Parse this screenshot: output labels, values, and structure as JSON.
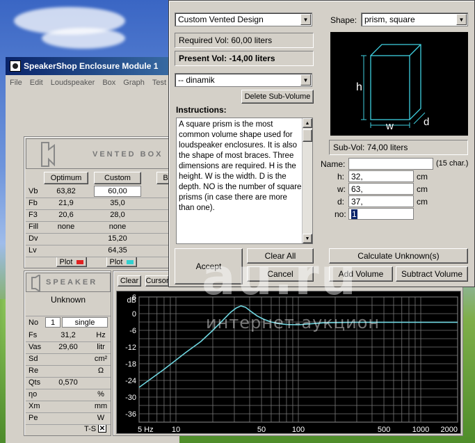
{
  "main_window": {
    "title": "SpeakerShop Enclosure Module 1",
    "menu": [
      "File",
      "Edit",
      "Loudspeaker",
      "Box",
      "Graph",
      "Test"
    ]
  },
  "vented_box": {
    "header": "VENTED BOX",
    "col_optimum": "Optimum",
    "col_custom": "Custom",
    "col_b": "B",
    "rows": [
      {
        "label": "Vb",
        "optimum": "63,82",
        "custom": "60,00"
      },
      {
        "label": "Fb",
        "optimum": "21,9",
        "custom": "35,0"
      },
      {
        "label": "F3",
        "optimum": "20,6",
        "custom": "28,0"
      },
      {
        "label": "Fill",
        "optimum": "none",
        "custom": "none"
      },
      {
        "label": "Dv",
        "optimum": "",
        "custom": "15,20"
      },
      {
        "label": "Lv",
        "optimum": "",
        "custom": "64,35"
      }
    ],
    "plot_label": "Plot",
    "plot_colors": {
      "optimum": "#e02020",
      "custom": "#30d0d0"
    }
  },
  "speaker": {
    "header": "SPEAKER",
    "name": "Unknown",
    "no_label": "No",
    "no_value": "1",
    "no_mode": "single",
    "rows": [
      {
        "label": "Fs",
        "value": "31,2",
        "unit": "Hz"
      },
      {
        "label": "Vas",
        "value": "29,60",
        "unit": "litr"
      },
      {
        "label": "Sd",
        "value": "",
        "unit": "cm²"
      },
      {
        "label": "Re",
        "value": "",
        "unit": "Ω"
      },
      {
        "label": "Qts",
        "value": "0,570",
        "unit": ""
      },
      {
        "label": "ηo",
        "value": "",
        "unit": "%"
      },
      {
        "label": "Xm",
        "value": "",
        "unit": "mm"
      },
      {
        "label": "Pe",
        "value": "",
        "unit": "W"
      }
    ],
    "ts_label": "T-S"
  },
  "graph": {
    "clear_button": "Clear",
    "cursor_button": "Cursor",
    "ylabel": "dB",
    "chart_data": {
      "type": "line",
      "xscale": "log",
      "xlim": [
        5,
        2000
      ],
      "ylim": [
        -39,
        6
      ],
      "x_ticks": [
        "5 Hz",
        "10",
        "50",
        "100",
        "500",
        "1000",
        "2000"
      ],
      "y_ticks": [
        "6",
        "0",
        "-6",
        "-12",
        "-18",
        "-24",
        "-30",
        "-36"
      ],
      "y_tick_values": [
        6,
        0,
        -6,
        -12,
        -18,
        -24,
        -30,
        -36
      ],
      "series": [
        {
          "color": "#6fd6e0",
          "x": [
            5,
            8,
            12,
            16,
            20,
            24,
            28,
            31,
            34,
            37,
            41,
            46,
            52,
            60,
            70,
            80,
            100,
            130,
            160,
            200,
            300,
            500,
            1000,
            2000
          ],
          "y": [
            -26.5,
            -20,
            -14,
            -10,
            -6,
            -2.5,
            0.5,
            2,
            2.8,
            2.3,
            0.8,
            -0.8,
            -2,
            -3,
            -3.6,
            -3.9,
            -4,
            -3.6,
            -3.3,
            -3.2,
            -3.1,
            -3.1,
            -3.1,
            -3.1
          ]
        }
      ]
    }
  },
  "dialog": {
    "design_select": "Custom Vented Design",
    "required_vol": "Required Vol: 60,00 liters",
    "present_vol": "Present Vol: -14,00 liters",
    "subvolume_select": "-- dinamik",
    "delete_subvolume": "Delete Sub-Volume",
    "instructions_label": "Instructions:",
    "instructions": "A square prism is the most common volume shape used for loudspeaker enclosures. It is also the shape of most braces. Three dimensions are required. H is the height. W is the width. D is the depth. NO is the number of square prisms (in case there are more than one).",
    "shape_label": "Shape:",
    "shape_select": "prism, square",
    "diagram_labels": {
      "h": "h",
      "w": "w",
      "d": "d"
    },
    "subvol": "Sub-Vol: 74,00 liters",
    "name_label": "Name:",
    "name_value": "",
    "name_hint": "(15 char.)",
    "h_label": "h:",
    "h_value": "32,",
    "w_label": "w:",
    "w_value": "63,",
    "d_label": "d:",
    "d_value": "37,",
    "no_label": "no:",
    "no_value": "1",
    "unit": "cm",
    "accept": "Accept",
    "clear_all": "Clear All",
    "cancel": "Cancel",
    "calculate": "Calculate Unknown(s)",
    "add_volume": "Add Volume",
    "subtract_volume": "Subtract Volume"
  },
  "watermark": {
    "logo": "au.ru",
    "tagline": "интернет-аукцион"
  }
}
